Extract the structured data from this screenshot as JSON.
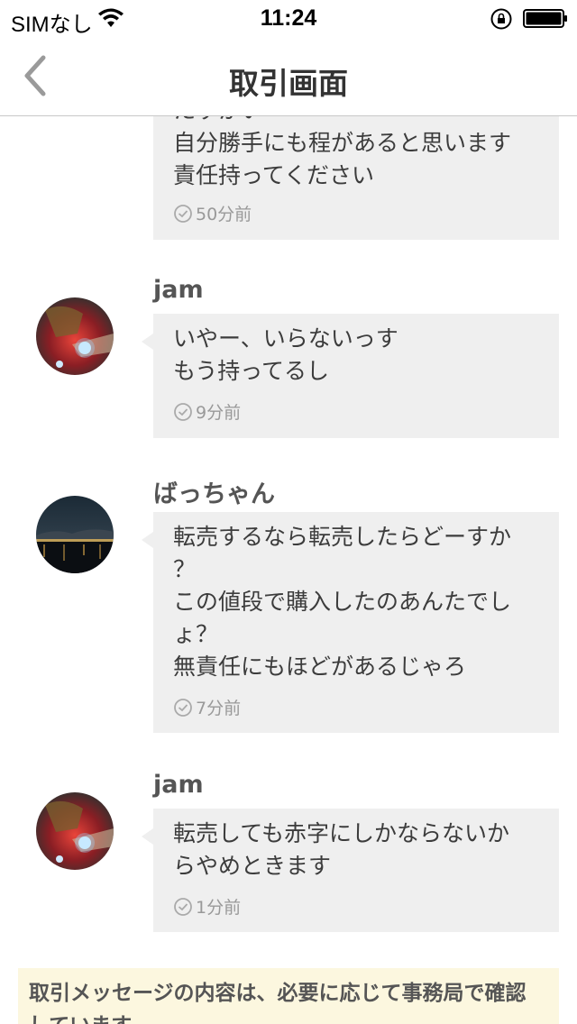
{
  "status_bar": {
    "carrier": "SIMなし",
    "time": "11:24"
  },
  "nav": {
    "title": "取引画面"
  },
  "messages": [
    {
      "sender": "",
      "lines": [
        "たすかい",
        "自分勝手にも程があると思います",
        "責任持ってください"
      ],
      "time": "50分前"
    },
    {
      "sender": "jam",
      "lines": [
        "いやー、いらないっす",
        "もう持ってるし"
      ],
      "time": "9分前"
    },
    {
      "sender": "ばっちゃん",
      "lines": [
        "転売するなら転売したらどーすか",
        "？",
        "この値段で購入したのあんたでし",
        "ょ？",
        "無責任にもほどがあるじゃろ"
      ],
      "time": "7分前"
    },
    {
      "sender": "jam",
      "lines": [
        "転売しても赤字にしかならないか",
        "らやめときます"
      ],
      "time": "1分前"
    }
  ],
  "notice": {
    "lines": [
      "取引メッセージの内容は、必要に応じて事務局で確認",
      "しています。"
    ]
  },
  "colors": {
    "bubble_bg": "#efefef",
    "notice_bg": "#fcf7df",
    "text": "#3c3c3c"
  },
  "icons": [
    "back-chevron-icon",
    "clock-icon",
    "wifi-icon",
    "rotation-lock-icon",
    "battery-icon"
  ]
}
